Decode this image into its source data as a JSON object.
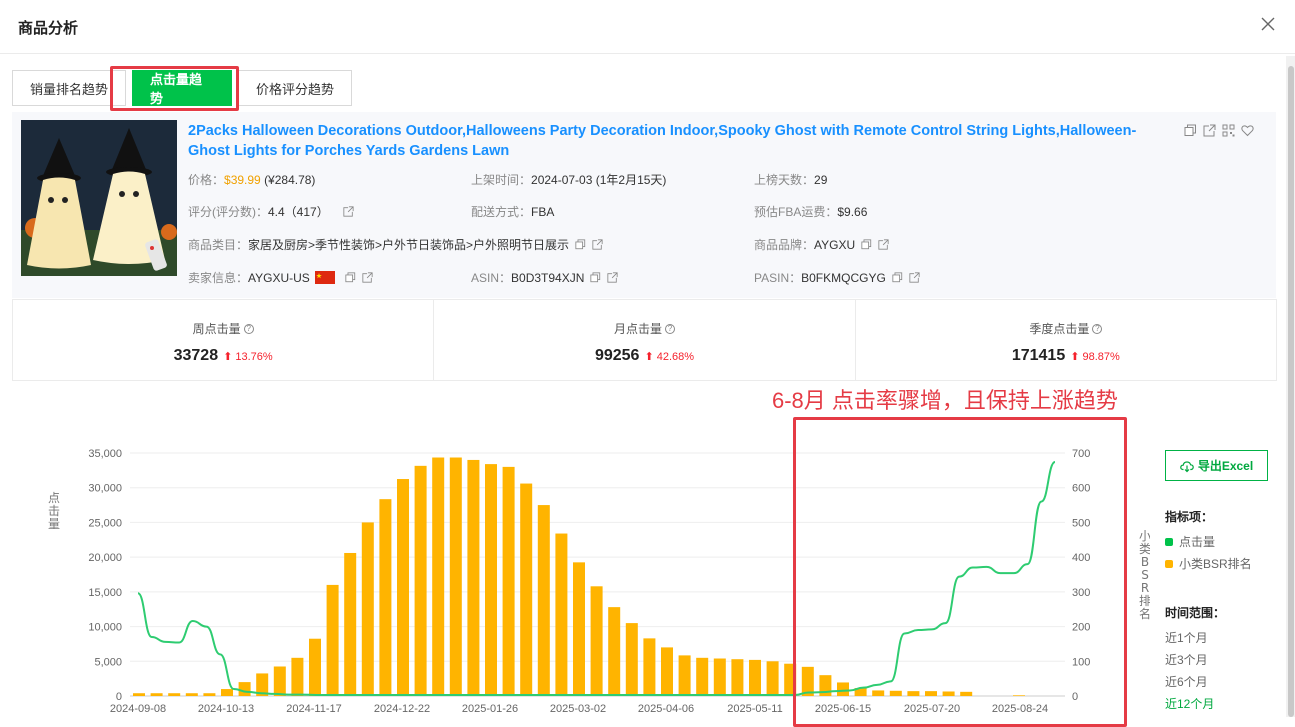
{
  "modal": {
    "title": "商品分析"
  },
  "tabs": [
    {
      "label": "销量排名趋势",
      "active": false
    },
    {
      "label": "点击量趋势",
      "active": true
    },
    {
      "label": "价格评分趋势",
      "active": false
    }
  ],
  "product": {
    "title": "2Packs Halloween Decorations Outdoor,Halloweens Party Decoration Indoor,Spooky Ghost with Remote Control String Lights,Halloween-Ghost Lights for Porches Yards Gardens Lawn",
    "price_label": "价格：",
    "price": "$39.99",
    "price_cny": "(¥284.78)",
    "listed_label": "上架时间：",
    "listed": "2024-07-03 (1年2月15天)",
    "days_label": "上榜天数：",
    "days": "29",
    "rating_label": "评分(评分数)：",
    "rating": "4.4（417）",
    "ship_label": "配送方式：",
    "ship": "FBA",
    "fba_label": "预估FBA运费：",
    "fba": "$9.66",
    "category_label": "商品类目：",
    "category": "家居及厨房>季节性装饰>户外节日装饰品>户外照明节日展示",
    "brand_label": "商品品牌：",
    "brand": "AYGXU",
    "seller_label": "卖家信息：",
    "seller": "AYGXU-US",
    "asin_label": "ASIN：",
    "asin": "B0D3T94XJN",
    "pasin_label": "PASIN：",
    "pasin": "B0FKMQCGYG"
  },
  "stats": [
    {
      "label": "周点击量",
      "value": "33728",
      "change": "13.76%"
    },
    {
      "label": "月点击量",
      "value": "99256",
      "change": "42.68%"
    },
    {
      "label": "季度点击量",
      "value": "171415",
      "change": "98.87%"
    }
  ],
  "annotation": "6-8月 点击率骤增，且保持上涨趋势",
  "sidebar": {
    "export_label": "导出Excel",
    "metrics_title": "指标项：",
    "metrics": [
      "点击量",
      "小类BSR排名"
    ],
    "range_title": "时间范围：",
    "ranges": [
      "近1个月",
      "近3个月",
      "近6个月",
      "近12个月"
    ],
    "active_range": 3
  },
  "colors": {
    "accent": "#00c24a",
    "bar": "#ffb400",
    "line": "#2ecc71",
    "highlight": "#e53b45"
  },
  "chart_data": {
    "type": "bar",
    "ylabel_left": "点击量",
    "ylabel_right": "小类BSR排名",
    "ylim_left": [
      0,
      35000
    ],
    "ylim_right": [
      0,
      700
    ],
    "yticks_left": [
      "0",
      "5,000",
      "10,000",
      "15,000",
      "20,000",
      "25,000",
      "30,000",
      "35,000"
    ],
    "yticks_right": [
      "0",
      "100",
      "200",
      "300",
      "400",
      "500",
      "600",
      "700"
    ],
    "xticks": [
      "2024-09-08",
      "2024-10-13",
      "2024-11-17",
      "2024-12-22",
      "2025-01-26",
      "2025-03-02",
      "2025-04-06",
      "2025-05-11",
      "2025-06-15",
      "2025-07-20",
      "2025-08-24"
    ],
    "series": [
      {
        "name": "点击量",
        "axis": "left",
        "kind": "line",
        "values": [
          14800,
          8500,
          7800,
          7700,
          10800,
          10000,
          6000,
          1000,
          600,
          400,
          300,
          200,
          200,
          150,
          150,
          150,
          150,
          150,
          150,
          150,
          150,
          150,
          150,
          150,
          150,
          150,
          150,
          150,
          150,
          150,
          150,
          150,
          150,
          150,
          150,
          150,
          150,
          150,
          150,
          150,
          150,
          150,
          150,
          150,
          150,
          150,
          150,
          150,
          150,
          500,
          550,
          700,
          800,
          1200,
          1600,
          2100,
          9000,
          9500,
          9600,
          10500,
          17200,
          18500,
          18600,
          17700,
          17700,
          19000,
          28000,
          33700
        ]
      },
      {
        "name": "小类BSR排名",
        "axis": "right",
        "kind": "bar",
        "values": [
          8,
          8,
          8,
          8,
          8,
          20,
          40,
          65,
          85,
          110,
          165,
          320,
          412,
          500,
          567,
          625,
          663,
          687,
          687,
          680,
          668,
          660,
          612,
          550,
          468,
          385,
          316,
          256,
          210,
          166,
          140,
          117,
          110,
          108,
          106,
          104,
          100,
          93,
          84,
          60,
          39,
          23,
          16,
          15,
          14,
          14,
          13,
          12,
          0,
          0,
          2
        ]
      }
    ]
  }
}
